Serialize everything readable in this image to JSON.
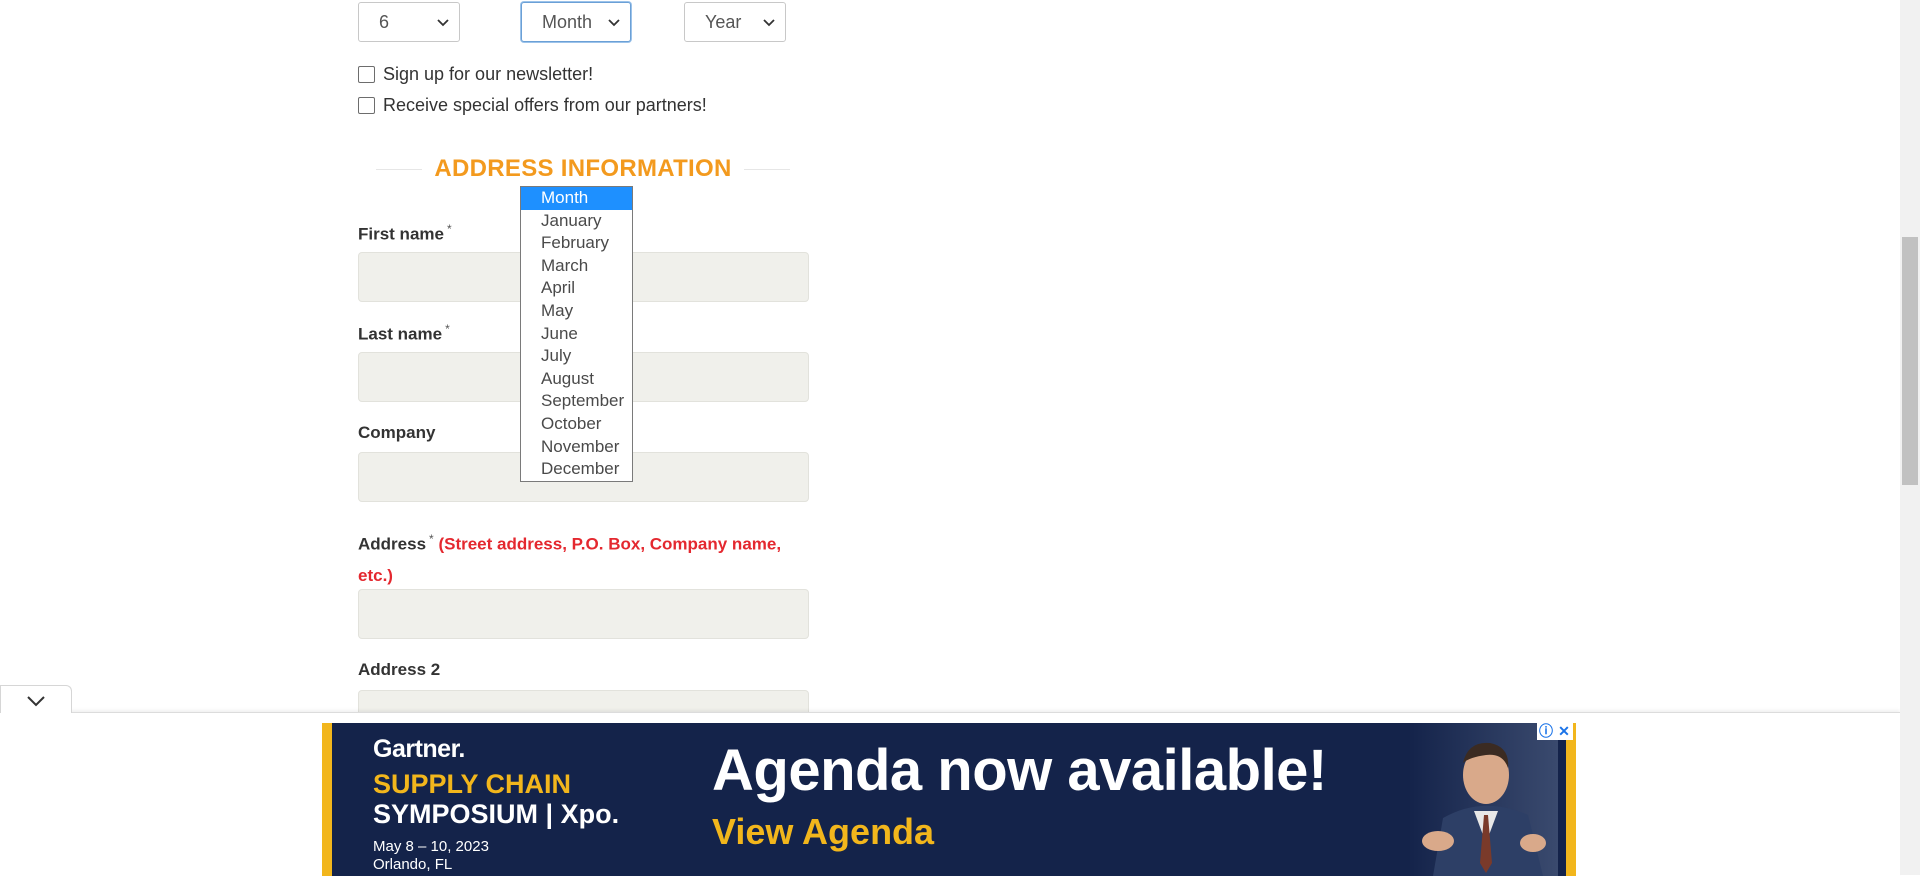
{
  "date_of_birth": {
    "day_value": "6",
    "month_value": "Month",
    "year_value": "Year"
  },
  "newsletter": {
    "label": "Sign up for our newsletter!"
  },
  "offers": {
    "label": "Receive special offers from our partners!"
  },
  "address_section": {
    "title": "ADDRESS INFORMATION"
  },
  "fields": {
    "first_name": "First name",
    "last_name": "Last name",
    "company": "Company",
    "address": "Address",
    "address_hint": "(Street address, P.O. Box, Company name, etc.)",
    "address2": "Address 2",
    "required_mark": "*"
  },
  "month_dropdown": {
    "options": [
      "Month",
      "January",
      "February",
      "March",
      "April",
      "May",
      "June",
      "July",
      "August",
      "September",
      "October",
      "November",
      "December"
    ],
    "selected": "Month"
  },
  "ad": {
    "brand": "Gartner.",
    "line1": "SUPPLY CHAIN",
    "line2": "SYMPOSIUM | Xpo.",
    "dates": "May 8 – 10, 2023",
    "location": "Orlando, FL",
    "headline": "Agenda now available!",
    "cta": "View Agenda",
    "info_icon": "ⓘ",
    "close_icon": "✕"
  },
  "colors": {
    "section_title": "#f39a1e",
    "hint": "#e4282f",
    "dropdown_selected": "#1e90ff",
    "ad_background": "#14234a",
    "ad_accent": "#f2b61c"
  }
}
